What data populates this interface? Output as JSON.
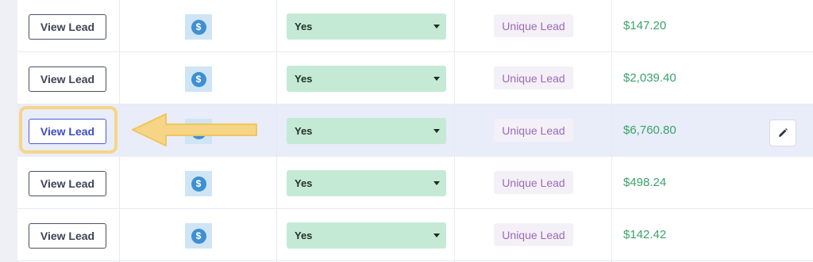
{
  "rows": [
    {
      "view_label": "View Lead",
      "dollar_glyph": "$",
      "select_value": "Yes",
      "badge": "Unique Lead",
      "price": "$147.20"
    },
    {
      "view_label": "View Lead",
      "dollar_glyph": "$",
      "select_value": "Yes",
      "badge": "Unique Lead",
      "price": "$2,039.40"
    },
    {
      "view_label": "View Lead",
      "dollar_glyph": "$",
      "select_value": "Yes",
      "badge": "Unique Lead",
      "price": "$6,760.80",
      "selected": true
    },
    {
      "view_label": "View Lead",
      "dollar_glyph": "$",
      "select_value": "Yes",
      "badge": "Unique Lead",
      "price": "$498.24"
    },
    {
      "view_label": "View Lead",
      "dollar_glyph": "$",
      "select_value": "Yes",
      "badge": "Unique Lead",
      "price": "$142.42"
    }
  ],
  "colors": {
    "select_bg": "#c4ead6",
    "badge_text": "#9b6bb5",
    "price_text": "#3aa36a",
    "dollar_icon": "#3f8fd1",
    "highlight": "#f6d586",
    "selected_row_bg": "#e9ecf9"
  },
  "icons": {
    "dollar": "dollar-icon",
    "caret": "caret-down-icon",
    "edit": "pencil-icon",
    "arrow": "arrow-left-icon"
  }
}
